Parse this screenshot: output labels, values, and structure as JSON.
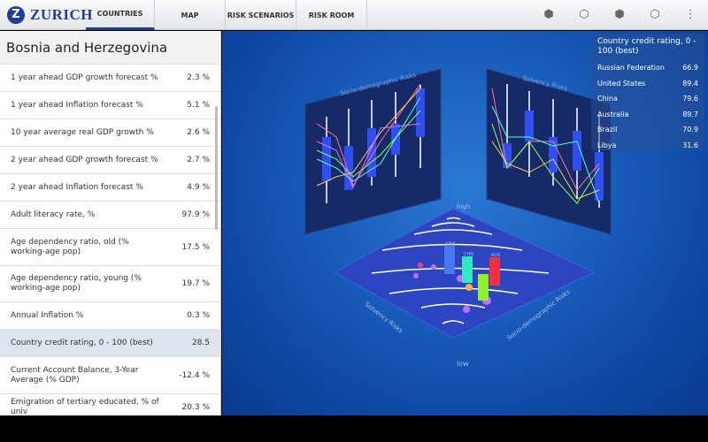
{
  "brand": "ZURICH",
  "tabs": [
    {
      "label": "COUNTRIES"
    },
    {
      "label": "MAP"
    },
    {
      "label": "RISK SCENARIOS"
    },
    {
      "label": "RISK ROOM"
    }
  ],
  "toolbar_icons": [
    "cube-view-1-icon",
    "cube-view-2-icon",
    "cube-view-3-icon",
    "cube-view-4-icon",
    "overflow-menu-icon"
  ],
  "country": "Bosnia and Herzegovina",
  "indicators": [
    {
      "label": "1 year ahead GDP growth forecast %",
      "value": "2.3 %"
    },
    {
      "label": "1 year ahead Inflation forecast %",
      "value": "5.1 %"
    },
    {
      "label": "10 year average real GDP growth %",
      "value": "2.6 %"
    },
    {
      "label": "2 year ahead GDP growth forecast %",
      "value": "2.7 %"
    },
    {
      "label": "2 year ahead Inflation forecast %",
      "value": "4.9 %"
    },
    {
      "label": "Adult literacy rate, %",
      "value": "97.9 %"
    },
    {
      "label": "Age dependency ratio, old (% working-age pop)",
      "value": "17.5 %"
    },
    {
      "label": "Age dependency ratio, young (% working-age pop)",
      "value": "19.7 %"
    },
    {
      "label": "Annual Inflation %",
      "value": "0.3 %"
    },
    {
      "label": "Country credit rating, 0 - 100 (best)",
      "value": "28.5"
    },
    {
      "label": "Current Account Balance, 3-Year Average (% GDP)",
      "value": "-12.4 %"
    },
    {
      "label": "Emigration of tertiary educated, % of univ",
      "value": "20.3 %"
    }
  ],
  "legend": {
    "title": "Country credit rating, 0 - 100 (best)",
    "entries": [
      {
        "name": "Russian Federation",
        "value": "66.9"
      },
      {
        "name": "United States",
        "value": "89.4"
      },
      {
        "name": "China",
        "value": "79.6"
      },
      {
        "name": "Australia",
        "value": "89.7"
      },
      {
        "name": "Brazil",
        "value": "70.9"
      },
      {
        "name": "Libya",
        "value": "31.6"
      }
    ]
  },
  "viz": {
    "panel_left_title": "Socio-demographic Risks",
    "panel_right_title": "Solvency Risks",
    "axis_high": "high",
    "axis_low": "low",
    "axis_left": "Solvency Risks",
    "axis_right": "Socio-demographic Risks",
    "bar_labels": [
      "USA",
      "CHN",
      "AUS"
    ]
  }
}
